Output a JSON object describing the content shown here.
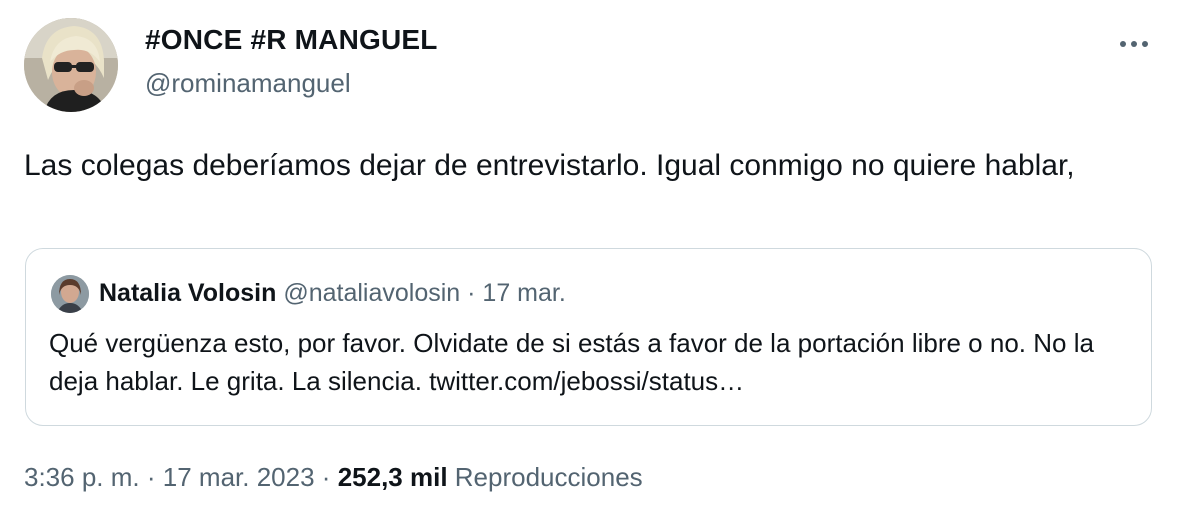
{
  "tweet": {
    "author": {
      "display_name": "#ONCE #R MANGUEL",
      "handle": "@rominamanguel"
    },
    "more_icon": "more-horizontal-icon",
    "text": "Las colegas deberíamos dejar de entrevistarlo. Igual conmigo no quiere hablar,",
    "quoted": {
      "display_name": "Natalia Volosin",
      "handle": "@nataliavolosin",
      "separator": "·",
      "date": "17 mar.",
      "text": "Qué vergüenza esto, por favor. Olvidate de si estás a favor de la portación libre o no. No la deja hablar. Le grita. La silencia. twitter.com/jebossi/status…"
    },
    "meta": {
      "time": "3:36 p. m.",
      "separator": "·",
      "date": "17 mar. 2023",
      "separator2": "·",
      "views_count": "252,3 mil",
      "views_label": "Reproducciones"
    }
  },
  "colors": {
    "text_primary": "#0f1419",
    "text_secondary": "#536471",
    "border": "#cfd9de",
    "background": "#ffffff"
  }
}
